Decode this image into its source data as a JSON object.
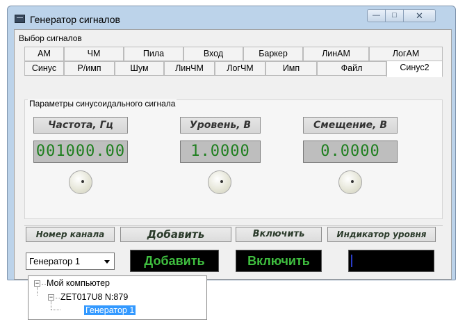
{
  "window": {
    "title": "Генератор сигналов",
    "controls": {
      "minimize": "—",
      "maximize": "□",
      "close": "✕"
    }
  },
  "signal_select": {
    "label": "Выбор сигналов",
    "tabs_row1": [
      "АМ",
      "ЧМ",
      "Пила",
      "Вход",
      "Баркер",
      "ЛинАМ",
      "ЛогАМ"
    ],
    "tabs_row2": [
      "Синус",
      "Р/имп",
      "Шум",
      "ЛинЧМ",
      "ЛогЧМ",
      "Имп",
      "Файл",
      "Синус2"
    ],
    "active_tab": "Синус2"
  },
  "params": {
    "title": "Параметры синусоидального сигнала",
    "frequency": {
      "label": "Частота, Гц",
      "value": "001000.00"
    },
    "level": {
      "label": "Уровень, В",
      "value": "1.0000"
    },
    "offset": {
      "label": "Смещение, В",
      "value": "0.0000"
    }
  },
  "bottom": {
    "channel_label": "Номер канала",
    "add_label": "Добавить",
    "enable_label": "Включить",
    "indicator_label": "Индикатор уровня",
    "generator_select": "Генератор 1",
    "add_button": "Добавить",
    "enable_button": "Включить",
    "level_fraction": 0.02
  },
  "tree": {
    "root": "Мой компьютер",
    "device": "ZET017U8 N:879",
    "generator": "Генератор 1"
  },
  "colors": {
    "lcd_text": "#1f7f1f",
    "button_text": "#3fbf3f",
    "level_bar": "#2a3cc9",
    "selection": "#3399ff"
  }
}
